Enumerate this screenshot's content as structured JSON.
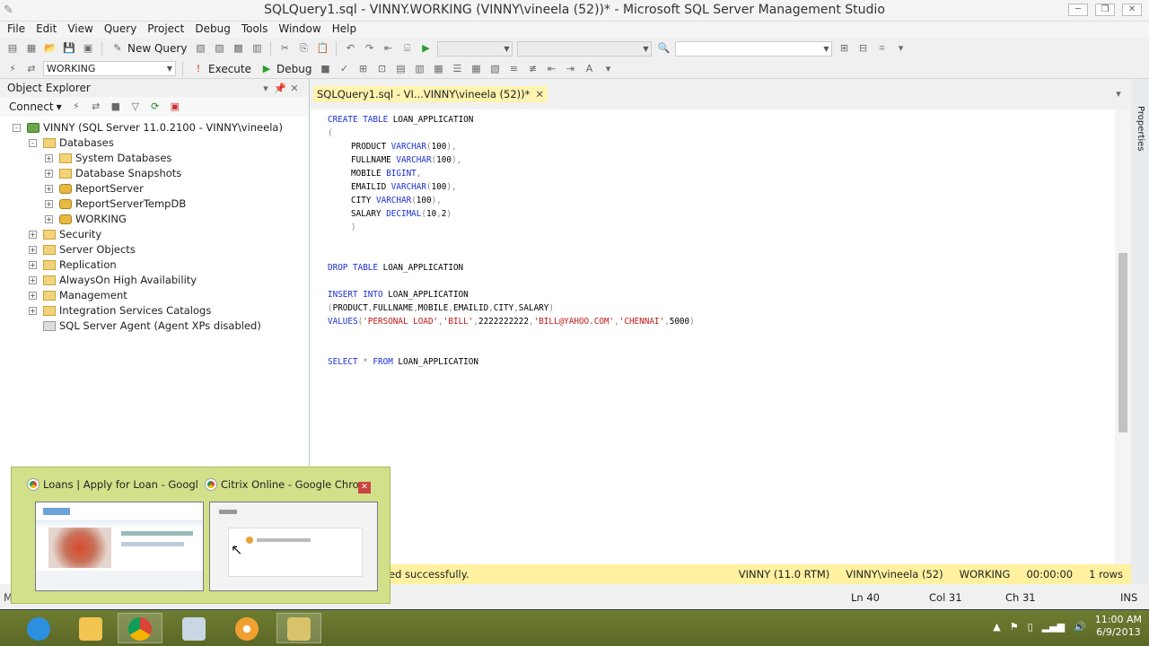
{
  "window": {
    "title": "SQLQuery1.sql - VINNY.WORKING (VINNY\\vineela (52))* - Microsoft SQL Server Management Studio"
  },
  "menu": [
    "File",
    "Edit",
    "View",
    "Query",
    "Project",
    "Debug",
    "Tools",
    "Window",
    "Help"
  ],
  "toolbar": {
    "new_query": "New Query",
    "database": "WORKING",
    "execute": "Execute",
    "debug": "Debug"
  },
  "object_explorer": {
    "title": "Object Explorer",
    "connect": "Connect",
    "nodes": [
      {
        "label": "VINNY (SQL Server 11.0.2100 - VINNY\\vineela)",
        "level": 0,
        "icon": "server-icon",
        "exp": "-"
      },
      {
        "label": "Databases",
        "level": 1,
        "icon": "folder-icon",
        "exp": "-"
      },
      {
        "label": "System Databases",
        "level": 2,
        "icon": "folder-icon",
        "exp": "+"
      },
      {
        "label": "Database Snapshots",
        "level": 2,
        "icon": "folder-icon",
        "exp": "+"
      },
      {
        "label": "ReportServer",
        "level": 2,
        "icon": "database-icon",
        "exp": "+"
      },
      {
        "label": "ReportServerTempDB",
        "level": 2,
        "icon": "database-icon",
        "exp": "+"
      },
      {
        "label": "WORKING",
        "level": 2,
        "icon": "database-icon",
        "exp": "+"
      },
      {
        "label": "Security",
        "level": 1,
        "icon": "folder-icon",
        "exp": "+"
      },
      {
        "label": "Server Objects",
        "level": 1,
        "icon": "folder-icon",
        "exp": "+"
      },
      {
        "label": "Replication",
        "level": 1,
        "icon": "folder-icon",
        "exp": "+"
      },
      {
        "label": "AlwaysOn High Availability",
        "level": 1,
        "icon": "folder-icon",
        "exp": "+"
      },
      {
        "label": "Management",
        "level": 1,
        "icon": "folder-icon",
        "exp": "+"
      },
      {
        "label": "Integration Services Catalogs",
        "level": 1,
        "icon": "folder-icon",
        "exp": "+"
      },
      {
        "label": "SQL Server Agent (Agent XPs disabled)",
        "level": 1,
        "icon": "agent-icon",
        "exp": ""
      }
    ]
  },
  "editor": {
    "tab_label": "SQLQuery1.sql - VI...VINNY\\vineela (52))*"
  },
  "code": [
    "CREATE TABLE LOAN_APPLICATION",
    "(",
    "PRODUCT VARCHAR(100),",
    "FULLNAME VARCHAR(100),",
    "MOBILE BIGINT,",
    "EMAILID VARCHAR(100),",
    "CITY VARCHAR(100),",
    "SALARY DECIMAL(10,2)",
    ")",
    "DROP TABLE LOAN_APPLICATION",
    "INSERT INTO LOAN_APPLICATION",
    "(PRODUCT,FULLNAME,MOBILE,EMAILID,CITY,SALARY)",
    "VALUES('PERSONAL LOAD','BILL',2222222222,'BILL@YAHOO.COM','CHENNAI',5000)",
    "SELECT * FROM LOAN_APPLICATION"
  ],
  "status": {
    "message": "ed successfully.",
    "server": "VINNY (11.0 RTM)",
    "user": "VINNY\\vineela (52)",
    "database": "WORKING",
    "time": "00:00:00",
    "rows": "1 rows"
  },
  "position": {
    "ln": "Ln 40",
    "col": "Col 31",
    "ch": "Ch 31",
    "mode": "INS",
    "left": "Messag"
  },
  "properties_tab": "Properties",
  "taskbar_preview": [
    {
      "title": "Loans | Apply for Loan - Google..."
    },
    {
      "title": "Citrix Online - Google Chro..."
    }
  ],
  "clock": {
    "time": "11:00 AM",
    "date": "6/9/2013"
  }
}
